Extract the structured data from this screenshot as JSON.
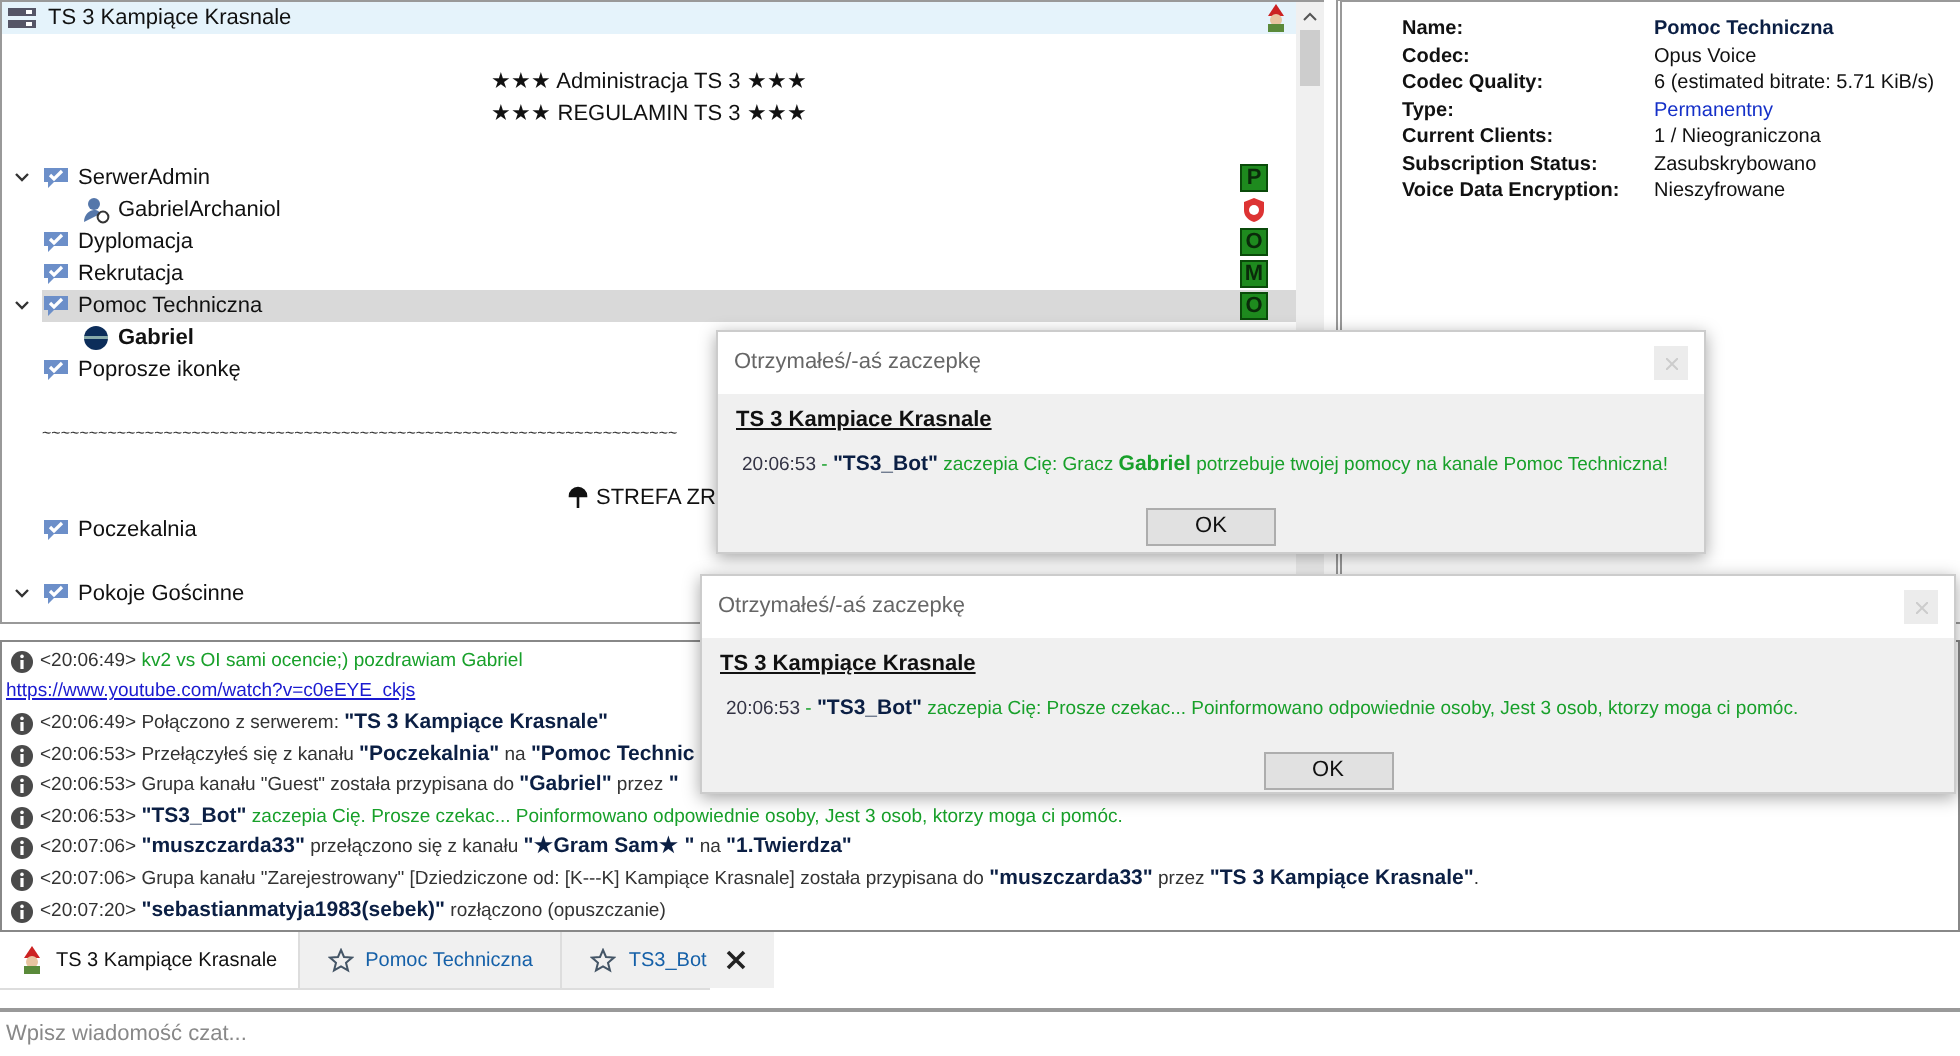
{
  "server": {
    "name": "TS 3 Kampiące Krasnale"
  },
  "tree": [
    {
      "kind": "blank"
    },
    {
      "kind": "spacer",
      "text": "★★★ Administracja TS 3 ★★★"
    },
    {
      "kind": "spacer",
      "text": "★★★ REGULAMIN TS 3 ★★★"
    },
    {
      "kind": "blank"
    },
    {
      "kind": "channel",
      "name": "SerwerAdmin",
      "expanded": true,
      "selected": false,
      "badge": "P",
      "children": [
        {
          "kind": "client",
          "name": "GabrielArchaniol",
          "bold": false,
          "shield": true
        }
      ]
    },
    {
      "kind": "channel",
      "name": "Dyplomacja",
      "selected": false,
      "badge": "O"
    },
    {
      "kind": "channel",
      "name": "Rekrutacja",
      "selected": false,
      "badge": "M"
    },
    {
      "kind": "channel",
      "name": "Pomoc Techniczna",
      "expanded": true,
      "selected": true,
      "badge": "O",
      "children": [
        {
          "kind": "client",
          "name": "Gabriel",
          "bold": true,
          "shield": false
        }
      ]
    },
    {
      "kind": "channel",
      "name": "Poprosze ikonkę",
      "selected": false
    },
    {
      "kind": "blank"
    },
    {
      "kind": "divider",
      "text": "~~~~~~~~~~~~~~~~~~~~~~~~~~~~~~~~~~~~~~~~~~~~~~~~~~~~~~~~~~~~~~~~~~~~"
    },
    {
      "kind": "blank"
    },
    {
      "kind": "partial",
      "text": "STREFA ZR"
    },
    {
      "kind": "channel",
      "name": "Poczekalnia",
      "selected": false
    },
    {
      "kind": "blank"
    },
    {
      "kind": "channel",
      "name": "Pokoje Gościnne",
      "expanded": true,
      "selected": false
    }
  ],
  "info": [
    {
      "label": "Name:",
      "value": "Pomoc Techniczna",
      "kind": "strong"
    },
    {
      "label": "Codec:",
      "value": "Opus Voice",
      "kind": "plain"
    },
    {
      "label": "Codec Quality:",
      "value": "6 (estimated bitrate: 5.71 KiB/s)",
      "kind": "plain"
    },
    {
      "label": "Type:",
      "value": "Permanentny",
      "kind": "link"
    },
    {
      "label": "Current Clients:",
      "value": "1 / Nieograniczona",
      "kind": "plain"
    },
    {
      "label": "Subscription Status:",
      "value": "Zasubskrybowano",
      "kind": "plain"
    },
    {
      "label": "Voice Data Encryption:",
      "value": "Nieszyfrowane",
      "kind": "plain"
    }
  ],
  "chat": [
    {
      "time": "<20:06:49>",
      "segments": [
        {
          "kind": "green",
          "text": "kv2 vs OI sami ocencie;) pozdrawiam Gabriel"
        }
      ],
      "link": "https://www.youtube.com/watch?v=c0eEYE_ckjs"
    },
    {
      "time": "<20:06:49>",
      "segments": [
        {
          "kind": "plain",
          "text": "Połączono z serwerem: "
        },
        {
          "kind": "name",
          "text": "\"TS 3 Kampiące Krasnale\""
        }
      ]
    },
    {
      "time": "<20:06:53>",
      "segments": [
        {
          "kind": "plain",
          "text": "Przełączyłeś się z kanału "
        },
        {
          "kind": "name",
          "text": "\"Poczekalnia\""
        },
        {
          "kind": "plain",
          "text": " na "
        },
        {
          "kind": "name",
          "text": "\"Pomoc Technic"
        }
      ]
    },
    {
      "time": "<20:06:53>",
      "segments": [
        {
          "kind": "plain",
          "text": "Grupa kanału \"Guest\" została przypisana do "
        },
        {
          "kind": "name",
          "text": "\"Gabriel\""
        },
        {
          "kind": "plain",
          "text": " przez "
        },
        {
          "kind": "name",
          "text": "\""
        }
      ]
    },
    {
      "time": "<20:06:53>",
      "segments": [
        {
          "kind": "name",
          "text": "\"TS3_Bot\""
        },
        {
          "kind": "green",
          "text": " zaczepia Cię. Prosze czekac... Poinformowano odpowiednie osoby, Jest 3 osob, ktorzy moga ci pomóc."
        }
      ]
    },
    {
      "time": "<20:07:06>",
      "segments": [
        {
          "kind": "name",
          "text": "\"muszczarda33\""
        },
        {
          "kind": "plain",
          "text": " przełączono się z kanału "
        },
        {
          "kind": "name",
          "text": "\"★Gram Sam★ \""
        },
        {
          "kind": "plain",
          "text": " na "
        },
        {
          "kind": "name",
          "text": "\"1.Twierdza\""
        }
      ]
    },
    {
      "time": "<20:07:06>",
      "segments": [
        {
          "kind": "plain",
          "text": "Grupa kanału \"Zarejestrowany\" [Dziedziczone od: [K---K] Kampiące Krasnale] została przypisana do "
        },
        {
          "kind": "name",
          "text": "\"muszczarda33\""
        },
        {
          "kind": "plain",
          "text": " przez "
        },
        {
          "kind": "name",
          "text": "\"TS 3 Kampiące Krasnale\""
        },
        {
          "kind": "plain",
          "text": "."
        }
      ]
    },
    {
      "time": "<20:07:20>",
      "segments": [
        {
          "kind": "name",
          "text": "\"sebastianmatyja1983(sebek)\""
        },
        {
          "kind": "plain",
          "text": " rozłączono (opuszczanie)"
        }
      ]
    }
  ],
  "tabs": [
    {
      "label": "TS 3 Kampiące Krasnale",
      "kind": "server",
      "selected": true
    },
    {
      "label": "Pomoc Techniczna",
      "kind": "channel",
      "selected": false
    },
    {
      "label": "TS3_Bot",
      "kind": "private",
      "selected": false,
      "closable": true
    }
  ],
  "input": {
    "placeholder": "Wpisz wiadomość czat..."
  },
  "dialogs": [
    {
      "title": "Otrzymałeś/-aś zaczepkę",
      "heading": "TS 3 Kampiace Krasnale",
      "segments": [
        {
          "kind": "time",
          "text": "20:06:53"
        },
        {
          "kind": "green",
          "text": " - "
        },
        {
          "kind": "name",
          "text": "\"TS3_Bot\""
        },
        {
          "kind": "green",
          "text": " zaczepia Cię: Gracz "
        },
        {
          "kind": "green_bold",
          "text": "Gabriel"
        },
        {
          "kind": "green",
          "text": " potrzebuje twojej pomocy na kanale Pomoc Techniczna!"
        }
      ],
      "button": "OK"
    },
    {
      "title": "Otrzymałeś/-aś zaczepkę",
      "heading": "TS 3 Kampiące Krasnale",
      "segments": [
        {
          "kind": "time",
          "text": "20:06:53"
        },
        {
          "kind": "green",
          "text": " - "
        },
        {
          "kind": "name",
          "text": "\"TS3_Bot\""
        },
        {
          "kind": "green",
          "text": " zaczepia Cię: Prosze czekac... Poinformowano odpowiednie osoby, Jest 3 osob, ktorzy moga ci pomóc."
        }
      ],
      "button": "OK"
    }
  ]
}
